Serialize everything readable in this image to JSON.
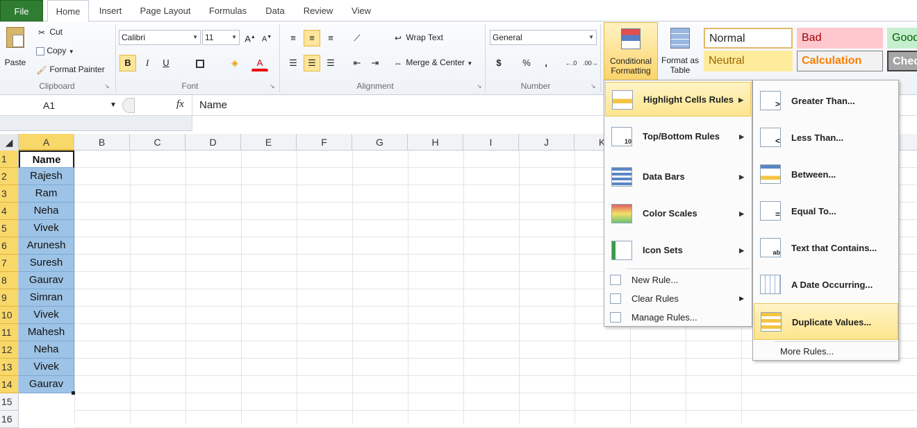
{
  "tabs": [
    "File",
    "Home",
    "Insert",
    "Page Layout",
    "Formulas",
    "Data",
    "Review",
    "View"
  ],
  "clipboard": {
    "paste": "Paste",
    "cut": "Cut",
    "copy": "Copy",
    "format_painter": "Format Painter",
    "label": "Clipboard"
  },
  "font": {
    "name": "Calibri",
    "size": "11",
    "label": "Font",
    "bold": "B",
    "italic": "I",
    "underline": "U",
    "font_color": "A"
  },
  "alignment": {
    "wrap_text": "Wrap Text",
    "merge_center": "Merge & Center",
    "label": "Alignment"
  },
  "number": {
    "format": "General",
    "currency": "$",
    "percent": "%",
    "comma": ",",
    "label": "Number"
  },
  "cf_button": {
    "line1": "Conditional",
    "line2": "Formatting"
  },
  "format_table": {
    "line1": "Format as",
    "line2": "Table"
  },
  "styles": {
    "normal": "Normal",
    "bad": "Bad",
    "good": "Good",
    "neutral": "Neutral",
    "calculation": "Calculation",
    "check": "Check"
  },
  "formula_bar": {
    "name_box": "A1",
    "fx": "fx",
    "content": "Name"
  },
  "columns": [
    "A",
    "B",
    "C",
    "D",
    "E",
    "F",
    "G",
    "H",
    "I",
    "J",
    "K"
  ],
  "rows": [
    "1",
    "2",
    "3",
    "4",
    "5",
    "6",
    "7",
    "8",
    "9",
    "10",
    "11",
    "12",
    "13",
    "14",
    "15",
    "16"
  ],
  "cells": [
    "Name",
    "Rajesh",
    "Ram",
    "Neha",
    "Vivek",
    "Arunesh",
    "Suresh",
    "Gaurav",
    "Simran",
    "Vivek",
    "Mahesh",
    "Neha",
    "Vivek",
    "Gaurav"
  ],
  "cf_menu": {
    "highlight": "Highlight Cells Rules",
    "topbottom": "Top/Bottom Rules",
    "databars": "Data Bars",
    "colorscales": "Color Scales",
    "iconsets": "Icon Sets",
    "new_rule": "New Rule...",
    "clear_rules": "Clear Rules",
    "manage_rules": "Manage Rules..."
  },
  "sub_menu": {
    "greater": "Greater Than...",
    "less": "Less Than...",
    "between": "Between...",
    "equal": "Equal To...",
    "text_contains": "Text that Contains...",
    "date_occurring": "A Date Occurring...",
    "duplicate": "Duplicate Values...",
    "more": "More Rules..."
  },
  "colors": {
    "file_tab": "#2f7d32",
    "selection": "#9dc3e6",
    "highlight": "#fde58d",
    "row_header_sel": "#f9d86a"
  }
}
